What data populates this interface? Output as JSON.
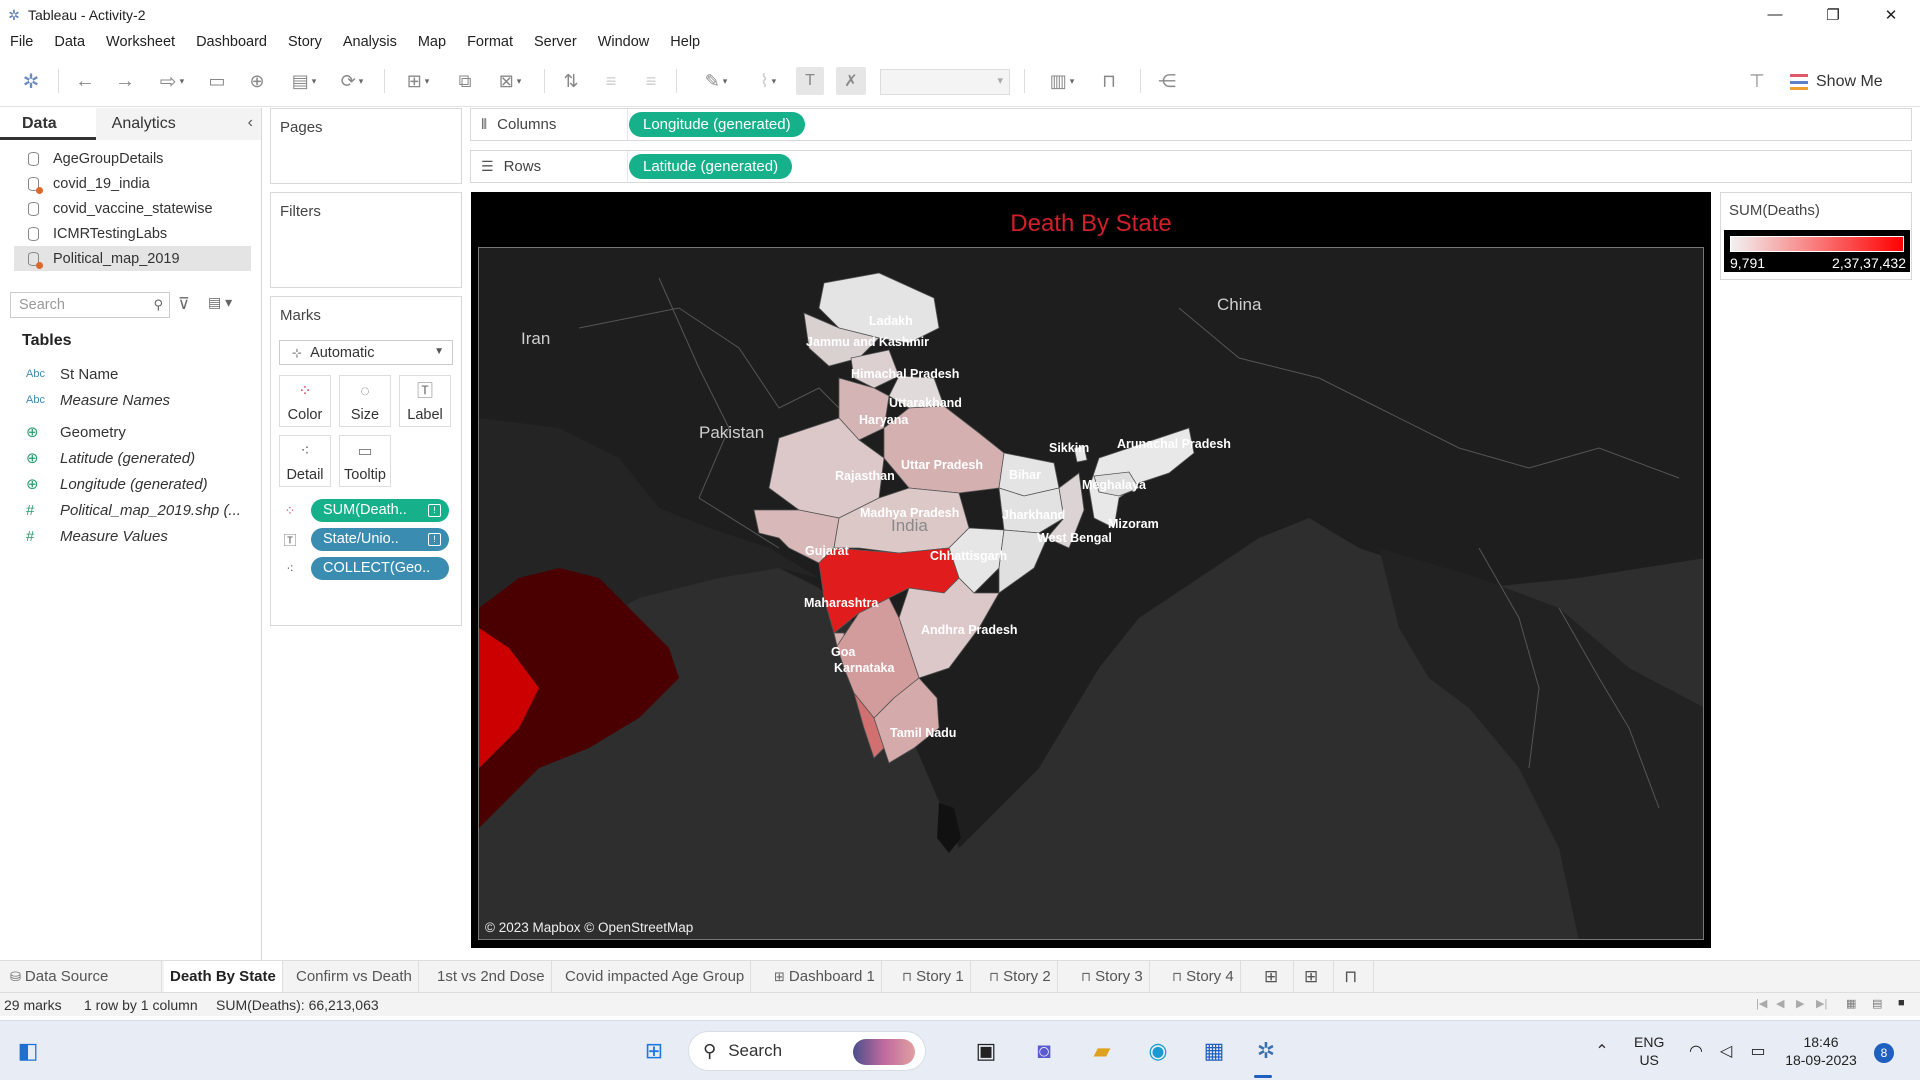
{
  "window": {
    "title": "Tableau - Activity-2"
  },
  "menu": [
    "File",
    "Data",
    "Worksheet",
    "Dashboard",
    "Story",
    "Analysis",
    "Map",
    "Format",
    "Server",
    "Window",
    "Help"
  ],
  "toolbar": {
    "show_me": "Show Me"
  },
  "data_pane": {
    "tab_data": "Data",
    "tab_analytics": "Analytics",
    "sources": [
      "AgeGroupDetails",
      "covid_19_india",
      "covid_vaccine_statewise",
      "ICMRTestingLabs",
      "Political_map_2019"
    ],
    "search_placeholder": "Search",
    "tables_header": "Tables",
    "fields": [
      {
        "type": "Abc",
        "name": "St Name"
      },
      {
        "type": "Abc",
        "name": "Measure Names"
      },
      {
        "type": "globe",
        "name": "Geometry"
      },
      {
        "type": "globe",
        "name": "Latitude (generated)"
      },
      {
        "type": "globe",
        "name": "Longitude (generated)"
      },
      {
        "type": "#",
        "name": "Political_map_2019.shp (..."
      },
      {
        "type": "#",
        "name": "Measure Values"
      }
    ]
  },
  "cards": {
    "pages": "Pages",
    "filters": "Filters",
    "marks": "Marks",
    "mark_type": "Automatic",
    "mark_buttons": [
      "Color",
      "Size",
      "Label",
      "Detail",
      "Tooltip"
    ],
    "mark_pills": [
      "SUM(Death..",
      "State/Unio..",
      "COLLECT(Geo.."
    ]
  },
  "shelves": {
    "columns_label": "Columns",
    "columns_pill": "Longitude (generated)",
    "rows_label": "Rows",
    "rows_pill": "Latitude (generated)"
  },
  "view": {
    "title": "Death By State",
    "attribution": "© 2023 Mapbox © OpenStreetMap",
    "countries": [
      "Iran",
      "Pakistan",
      "China",
      "India"
    ],
    "state_labels": [
      "Ladakh",
      "Jammu and Kashmir",
      "Himachal Pradesh",
      "Uttarakhand",
      "Haryana",
      "Uttar Pradesh",
      "Rajasthan",
      "Bihar",
      "Sikkim",
      "Arunachal Pradesh",
      "Meghalaya",
      "Madhya Pradesh",
      "Jharkhand",
      "West Bengal",
      "Mizoram",
      "Gujarat",
      "Chhattisgarh",
      "Maharashtra",
      "Andhra Pradesh",
      "Goa",
      "Karnataka",
      "Tamil Nadu"
    ]
  },
  "legend": {
    "title": "SUM(Deaths)",
    "min": "9,791",
    "max": "2,37,37,432"
  },
  "sheet_tabs": {
    "data_source": "Data Source",
    "sheets": [
      "Death By State",
      "Confirm vs Death",
      "1st vs 2nd Dose",
      "Covid impacted Age Group"
    ],
    "dashboards": [
      "Dashboard 1"
    ],
    "stories": [
      "Story 1",
      "Story 2",
      "Story 3",
      "Story 4"
    ]
  },
  "status": {
    "marks": "29 marks",
    "layout": "1 row by 1 column",
    "sum": "SUM(Deaths): 66,213,063"
  },
  "taskbar": {
    "search": "Search",
    "lang1": "ENG",
    "lang2": "US",
    "time": "18:46",
    "date": "18-09-2023",
    "notifications": "8"
  }
}
